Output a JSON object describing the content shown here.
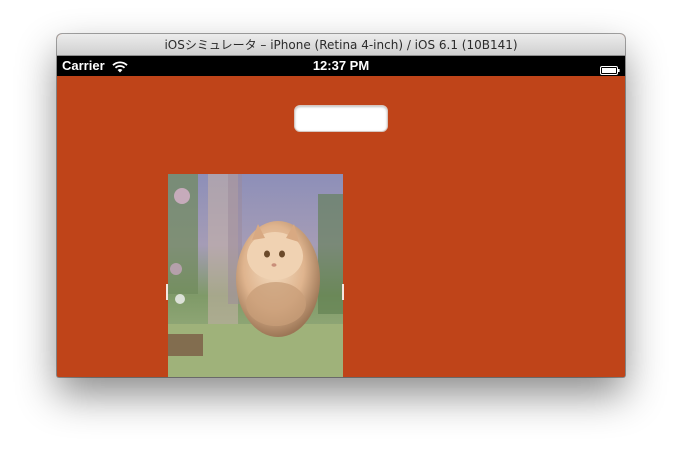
{
  "window": {
    "title": "iOSシミュレータ – iPhone (Retina 4-inch) / iOS 6.1 (10B141)"
  },
  "status_bar": {
    "carrier": "Carrier",
    "time": "12:37 PM",
    "icons": [
      "wifi-icon",
      "battery-icon"
    ]
  },
  "app": {
    "background_color": "#bf4419",
    "text_field": {
      "value": "",
      "placeholder": ""
    },
    "image": {
      "subject": "cat-photo"
    }
  }
}
